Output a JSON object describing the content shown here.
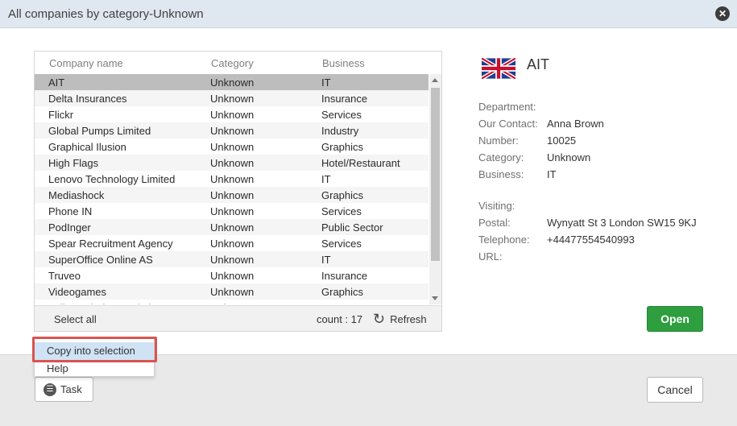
{
  "dialog": {
    "title": "All companies by category-Unknown",
    "close_icon": "close-icon"
  },
  "grid": {
    "columns": [
      "Company name",
      "Category",
      "Business"
    ],
    "rows": [
      {
        "name": "AIT",
        "category": "Unknown",
        "business": "IT",
        "selected": true
      },
      {
        "name": "Delta Insurances",
        "category": "Unknown",
        "business": "Insurance"
      },
      {
        "name": "Flickr",
        "category": "Unknown",
        "business": "Services"
      },
      {
        "name": "Global Pumps Limited",
        "category": "Unknown",
        "business": "Industry"
      },
      {
        "name": "Graphical Ilusion",
        "category": "Unknown",
        "business": "Graphics"
      },
      {
        "name": "High Flags",
        "category": "Unknown",
        "business": "Hotel/Restaurant"
      },
      {
        "name": "Lenovo Technology Limited",
        "category": "Unknown",
        "business": "IT"
      },
      {
        "name": "Mediashock",
        "category": "Unknown",
        "business": "Graphics"
      },
      {
        "name": "Phone IN",
        "category": "Unknown",
        "business": "Services"
      },
      {
        "name": "PodInger",
        "category": "Unknown",
        "business": "Public Sector"
      },
      {
        "name": "Spear Recruitment Agency",
        "category": "Unknown",
        "business": "Services"
      },
      {
        "name": "SuperOffice Online AS",
        "category": "Unknown",
        "business": "IT"
      },
      {
        "name": "Truveo",
        "category": "Unknown",
        "business": "Insurance"
      },
      {
        "name": "Videogames",
        "category": "Unknown",
        "business": "Graphics"
      },
      {
        "name": "Yellow Windows solutions",
        "category": "Unknown",
        "business": "IT"
      }
    ],
    "footer": {
      "select_all": "Select all",
      "count": "count : 17",
      "refresh": "Refresh"
    }
  },
  "detail": {
    "company": "AIT",
    "flag_icon": "uk-flag-icon",
    "fields": {
      "department_label": "Department:",
      "department_value": "",
      "contact_label": "Our Contact:",
      "contact_value": "Anna Brown",
      "number_label": "Number:",
      "number_value": "10025",
      "category_label": "Category:",
      "category_value": "Unknown",
      "business_label": "Business:",
      "business_value": "IT",
      "visiting_label": "Visiting:",
      "visiting_value": "",
      "postal_label": "Postal:",
      "postal_value": "Wynyatt St 3 London SW15 9KJ",
      "telephone_label": "Telephone:",
      "telephone_value": "+44477554540993",
      "url_label": "URL:",
      "url_value": ""
    },
    "open_button": "Open"
  },
  "menu": {
    "items": [
      "Copy into selection",
      "Help"
    ]
  },
  "bottom": {
    "task_button": "Task",
    "cancel_button": "Cancel"
  },
  "colors": {
    "titlebar": "#dfe8f1",
    "open_button": "#2e9e3f",
    "selected_row": "#bdbdbd",
    "menu_highlight": "#cfe3f5",
    "annotation": "#d9534f"
  }
}
